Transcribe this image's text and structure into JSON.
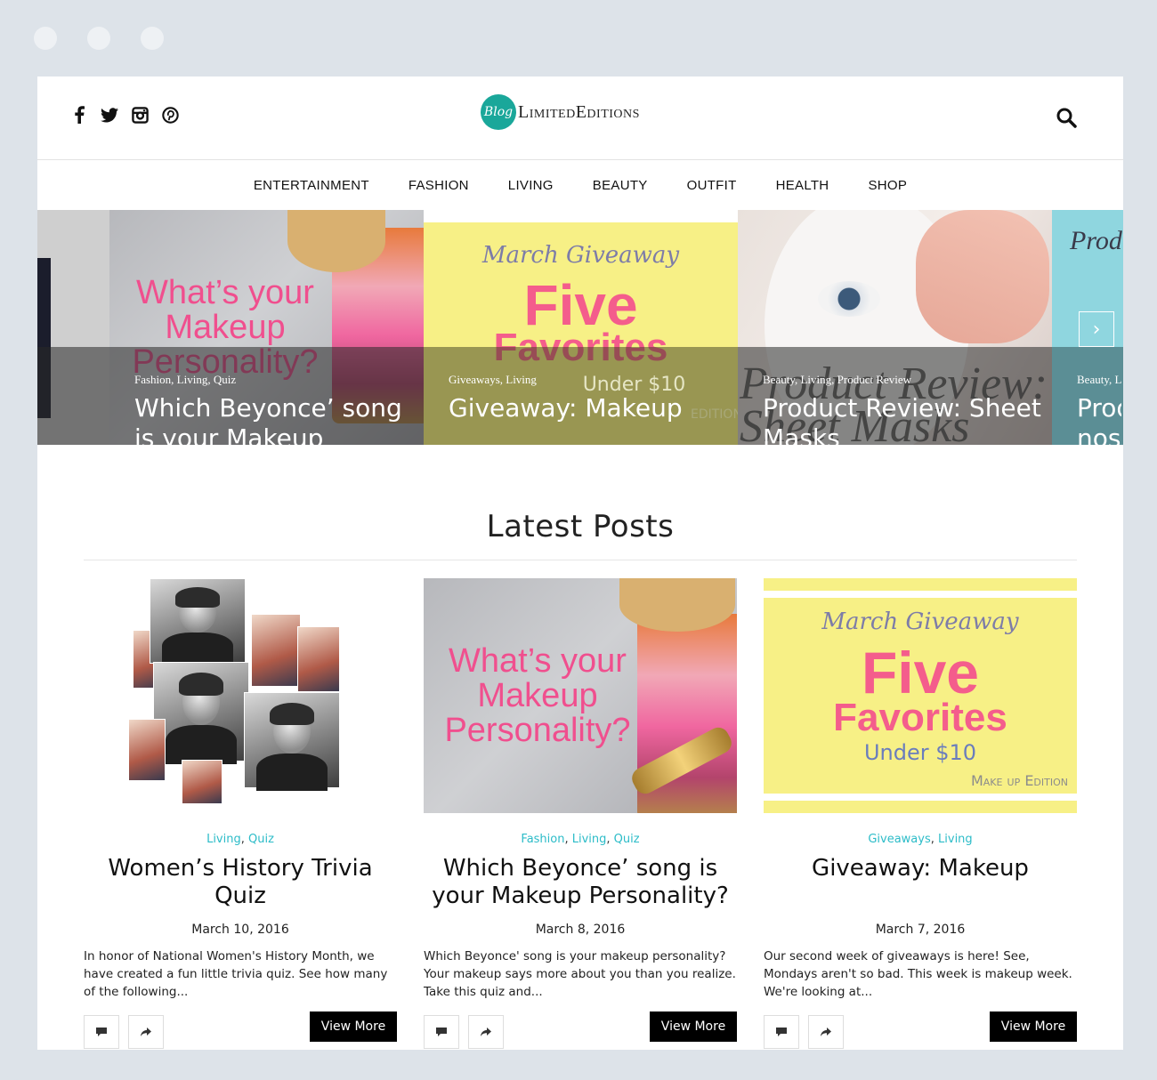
{
  "brand": {
    "badge": "Blog",
    "name": "LimitedEditions"
  },
  "social_icons": [
    "facebook-icon",
    "twitter-icon",
    "instagram-icon",
    "pinterest-icon"
  ],
  "nav": [
    "ENTERTAINMENT",
    "FASHION",
    "LIVING",
    "BEAUTY",
    "OUTFIT",
    "HEALTH",
    "SHOP"
  ],
  "slider": {
    "slides": [
      {
        "cats": "Fashion, Living, Quiz",
        "title": "Which Beyonce’ song is your Makeup",
        "art_text": "What’s your Makeup Personality?"
      },
      {
        "cats": "Giveaways, Living",
        "title": "Giveaway: Makeup",
        "art_top": "March Giveaway",
        "art_five": "Five",
        "art_fav": "Favorites",
        "art_under": "Under $10",
        "art_edition": "EDITION"
      },
      {
        "cats": "Beauty, Living, Product Review",
        "title": "Product Review: Sheet Masks",
        "art_text": "Product Review: Sheet Masks"
      },
      {
        "cats": "Beauty, L",
        "title": "Prod nose",
        "art_text": "Prod"
      }
    ]
  },
  "latest": {
    "heading": "Latest Posts",
    "posts": [
      {
        "cats": [
          "Living",
          "Quiz"
        ],
        "title": "Women’s History Trivia Quiz",
        "date": "March 10, 2016",
        "excerpt": "In honor of National Women's History Month, we have created a fun little trivia quiz. See how many of the following...",
        "button": "View More"
      },
      {
        "cats": [
          "Fashion",
          "Living",
          "Quiz"
        ],
        "title": "Which Beyonce’ song is your Makeup Personality?",
        "date": "March 8, 2016",
        "excerpt": "Which Beyonce' song is your makeup personality? Your makeup says more about you than you realize. Take this quiz and...",
        "button": "View More",
        "art_text": "What’s your Makeup Personality?"
      },
      {
        "cats": [
          "Giveaways",
          "Living"
        ],
        "title": "Giveaway: Makeup",
        "date": "March 7, 2016",
        "excerpt": "Our second week of giveaways is here! See, Mondays aren't so bad. This week is makeup week. We're looking at...",
        "button": "View More",
        "art_top": "March Giveaway",
        "art_five": "Five",
        "art_fav": "Favorites",
        "art_under": "Under $10",
        "art_edition": "Make up Edition"
      }
    ]
  },
  "colors": {
    "accent": "#2cbcc8",
    "logo": "#1aa79a",
    "pink": "#f04f8e",
    "yellow": "#f7f086"
  }
}
